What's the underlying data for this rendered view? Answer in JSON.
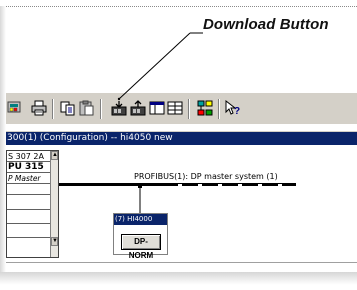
{
  "callout": {
    "label": "Download Button"
  },
  "toolbar": {
    "buttons": [
      {
        "icon": "download-station-icon"
      },
      {
        "icon": "print-icon"
      },
      {
        "icon": "copy-icon"
      },
      {
        "icon": "paste-icon"
      },
      {
        "icon": "download-to-module-icon"
      },
      {
        "icon": "upload-from-module-icon"
      },
      {
        "icon": "catalog-icon"
      },
      {
        "icon": "table-view-icon"
      },
      {
        "icon": "network-icon"
      },
      {
        "icon": "help-icon"
      }
    ]
  },
  "window": {
    "title": "300(1) (Configuration) -- hi4050 new"
  },
  "rack": {
    "rows": [
      "S 307 2A",
      "PU 315",
      "P Master",
      "",
      "",
      "",
      ""
    ],
    "scroll_up": "▲",
    "scroll_down": "▼"
  },
  "bus": {
    "label": "PROFIBUS(1): DP master system (1)"
  },
  "slave": {
    "title": "(7) HI4000",
    "button_label": "DP-NORM"
  },
  "colors": {
    "titlebar": "#0a246a",
    "toolbar": "#d4d0c8"
  }
}
